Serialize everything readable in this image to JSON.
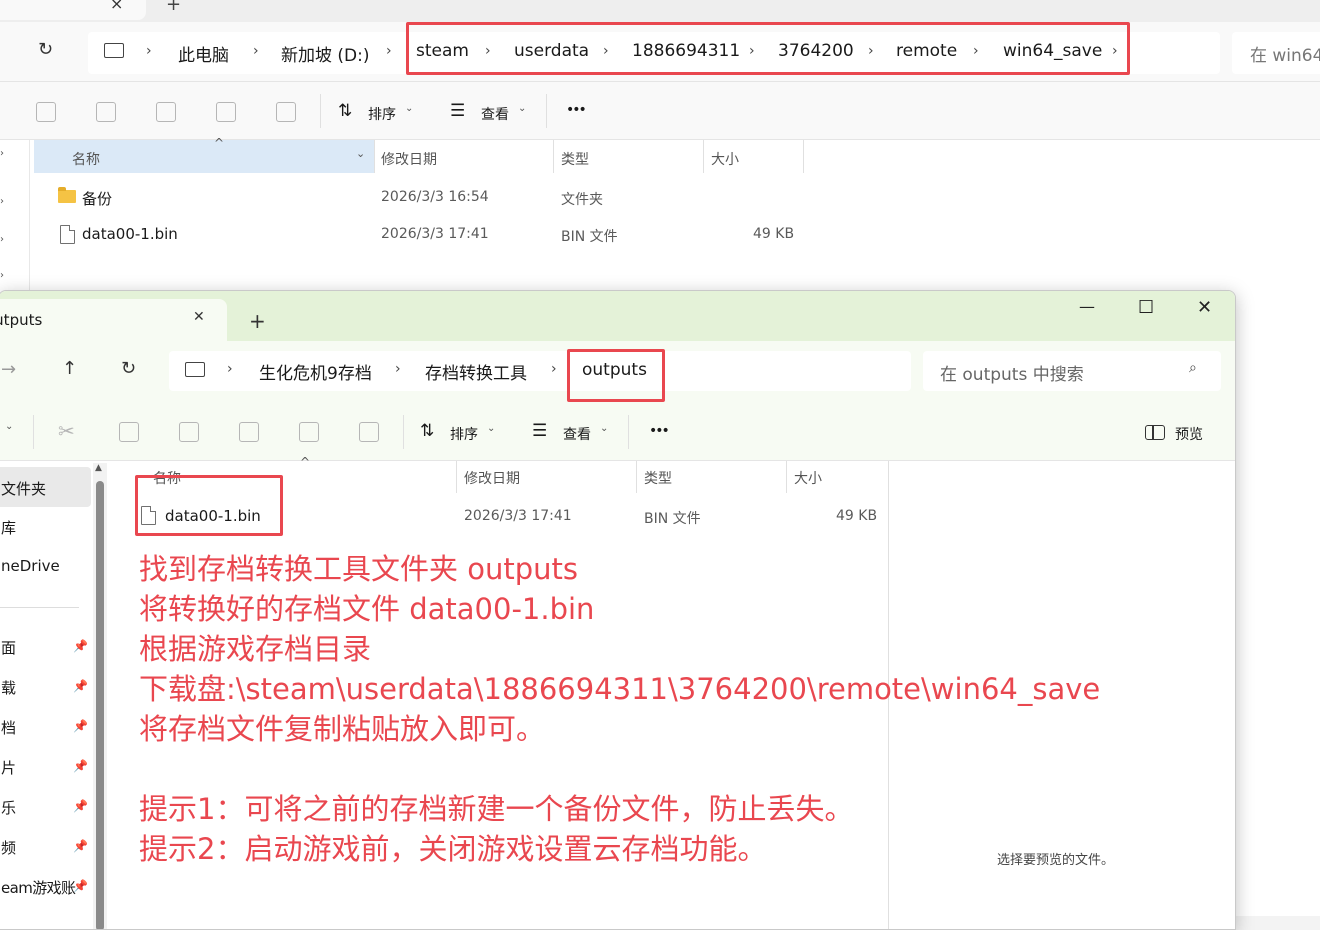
{
  "back": {
    "tab_add": "+",
    "tab_close": "×",
    "refresh": "↻",
    "breadcrumb": [
      "此电脑",
      "新加坡 (D:)",
      "steam",
      "userdata",
      "1886694311",
      "3764200",
      "remote",
      "win64_save"
    ],
    "search_placeholder": "在 win64",
    "toolbar": {
      "sort": "排序",
      "view": "查看",
      "more": "•••"
    },
    "columns": {
      "name": "名称",
      "modified": "修改日期",
      "type": "类型",
      "size": "大小"
    },
    "files": [
      {
        "name": "备份",
        "modified": "2026/3/3 16:54",
        "type": "文件夹",
        "size": ""
      },
      {
        "name": "data00-1.bin",
        "modified": "2026/3/3 17:41",
        "type": "BIN 文件",
        "size": "49 KB"
      }
    ]
  },
  "front": {
    "tab_title": "outputs",
    "tab_add": "+",
    "tab_close": "✕",
    "window_controls": {
      "minimize": "—",
      "maximize": "☐",
      "close": "✕"
    },
    "nav": {
      "forward": "→",
      "up": "↑",
      "refresh": "↻"
    },
    "breadcrumb": [
      "生化危机9存档",
      "存档转换工具",
      "outputs"
    ],
    "search_placeholder": "在 outputs 中搜索",
    "toolbar": {
      "sort": "排序",
      "view": "查看",
      "more": "•••",
      "preview": "预览"
    },
    "columns": {
      "name": "名称",
      "modified": "修改日期",
      "type": "类型",
      "size": "大小"
    },
    "files": [
      {
        "name": "data00-1.bin",
        "modified": "2026/3/3 17:41",
        "type": "BIN 文件",
        "size": "49 KB"
      }
    ],
    "sidebar": [
      "文件夹",
      "库",
      "neDrive",
      "面",
      "载",
      "档",
      "片",
      "乐",
      "频",
      "eam游戏账"
    ],
    "preview_hint": "选择要预览的文件。"
  },
  "instructions": [
    "找到存档转换工具文件夹 outputs",
    "将转换好的存档文件 data00-1.bin",
    "根据游戏存档目录",
    "下载盘:\\steam\\userdata\\1886694311\\3764200\\remote\\win64_save",
    "将存档文件复制粘贴放入即可。",
    "提示1：可将之前的存档新建一个备份文件，防止丢失。",
    "提示2：启动游戏前，关闭游戏设置云存档功能。"
  ],
  "colors": {
    "annotation_red": "#e9474f",
    "front_titlebar": "#e4f2d8"
  }
}
